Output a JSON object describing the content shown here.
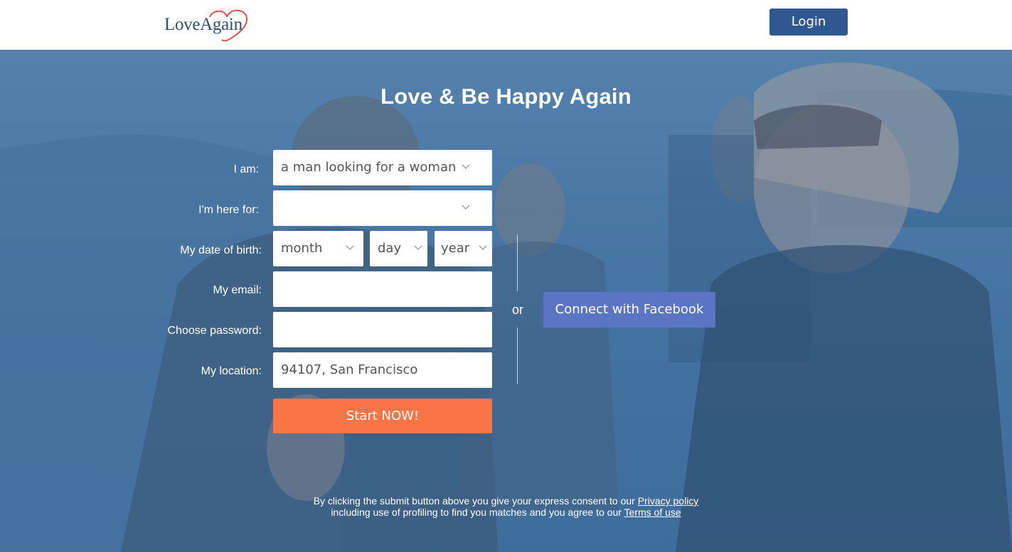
{
  "header": {
    "logo_text": "LoveAgain",
    "login_label": "Login"
  },
  "hero": {
    "headline": "Love & Be Happy Again"
  },
  "form": {
    "i_am": {
      "label": "I am:",
      "value": "a man looking for a woman"
    },
    "here_for": {
      "label": "I'm here for:",
      "value": ""
    },
    "dob": {
      "label": "My date of birth:",
      "month": "month",
      "day": "day",
      "year": "year"
    },
    "email": {
      "label": "My email:",
      "value": ""
    },
    "password": {
      "label": "Choose password:",
      "value": ""
    },
    "location": {
      "label": "My location:",
      "value": "94107, San Francisco"
    },
    "submit_label": "Start NOW!"
  },
  "social": {
    "or_text": "or",
    "facebook_label": "Connect with Facebook"
  },
  "consent": {
    "line1_prefix": "By clicking the submit button above you give your express consent to our ",
    "privacy_link": "Privacy policy",
    "line2_prefix": "including use of profiling to find you matches and you agree to our ",
    "terms_link": "Terms of use"
  },
  "colors": {
    "brand_blue": "#2f5891",
    "logo_heart": "#e0524a",
    "cta_orange": "#f97446",
    "facebook_blue": "#5b74c3"
  }
}
